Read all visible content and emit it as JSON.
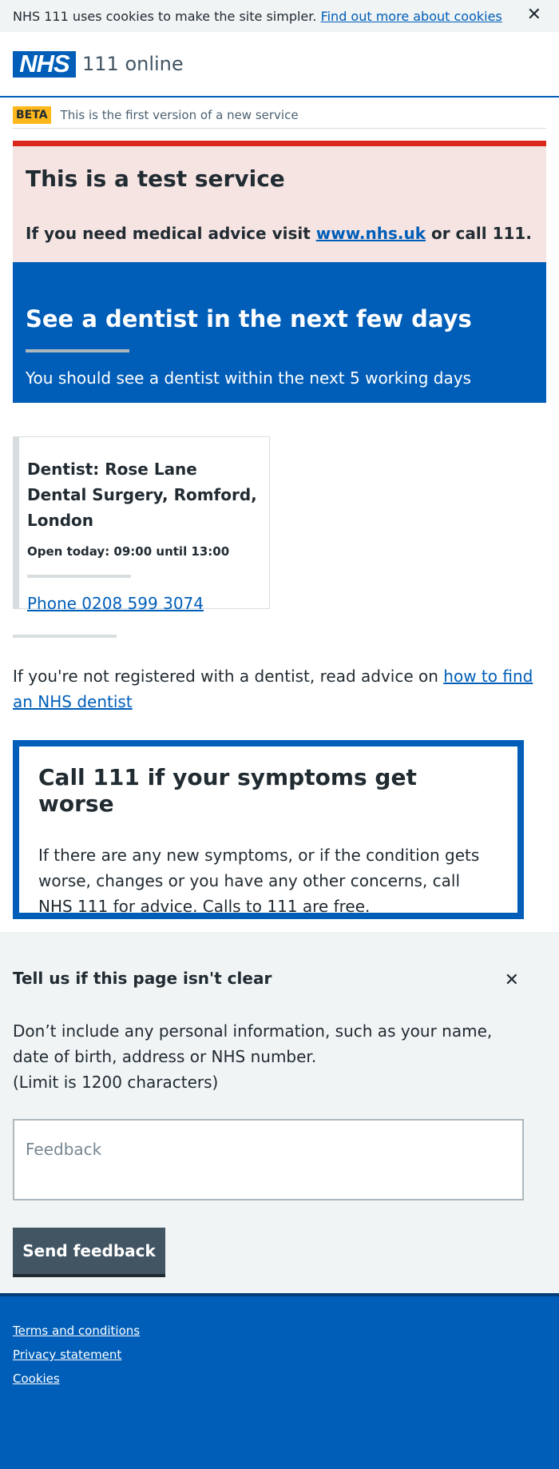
{
  "cookie_bar": {
    "text": "NHS 111 uses cookies to make the site simpler.",
    "link": "Find out more about cookies",
    "close": "✕"
  },
  "header": {
    "logo": "NHS",
    "service": "111 online"
  },
  "beta": {
    "tag": "BETA",
    "text": "This is the first version of a new service"
  },
  "test_warning": {
    "title": "This is a test service",
    "text_before": "If you need medical advice visit",
    "link": "www.nhs.uk",
    "text_after": "or call 111."
  },
  "result": {
    "title": "See a dentist in the next few days",
    "subtitle": "You should see a dentist within the next 5 working days"
  },
  "dentist_card": {
    "name": "Dentist: Rose Lane Dental Surgery, Romford, London",
    "hours": "Open today: 09:00 until 13:00",
    "phone": "Phone 0208 599 3074"
  },
  "register": {
    "text": "If you're not registered with a dentist, read advice on",
    "link": "how to find an NHS dentist"
  },
  "callout": {
    "title": "Call 111 if your symptoms get worse",
    "text": "If there are any new symptoms, or if the condition gets worse, changes or you have any other concerns, call NHS 111 for advice. Calls to 111 are free."
  },
  "feedback": {
    "title": "Tell us if this page isn't clear",
    "close": "✕",
    "note": "Don’t include any personal information, such as your name, date of birth, address or NHS number.",
    "limit": "(Limit is 1200 characters)",
    "placeholder": "Feedback",
    "button": "Send feedback"
  },
  "footer": {
    "links": [
      "Terms and conditions",
      "Privacy statement",
      "Cookies"
    ]
  },
  "colors": {
    "nhs_blue": "#005eb8",
    "warning_red": "#da291c",
    "warning_bg": "#f6e4e2",
    "beta_yellow": "#ffb81c",
    "button_grey": "#425563"
  }
}
